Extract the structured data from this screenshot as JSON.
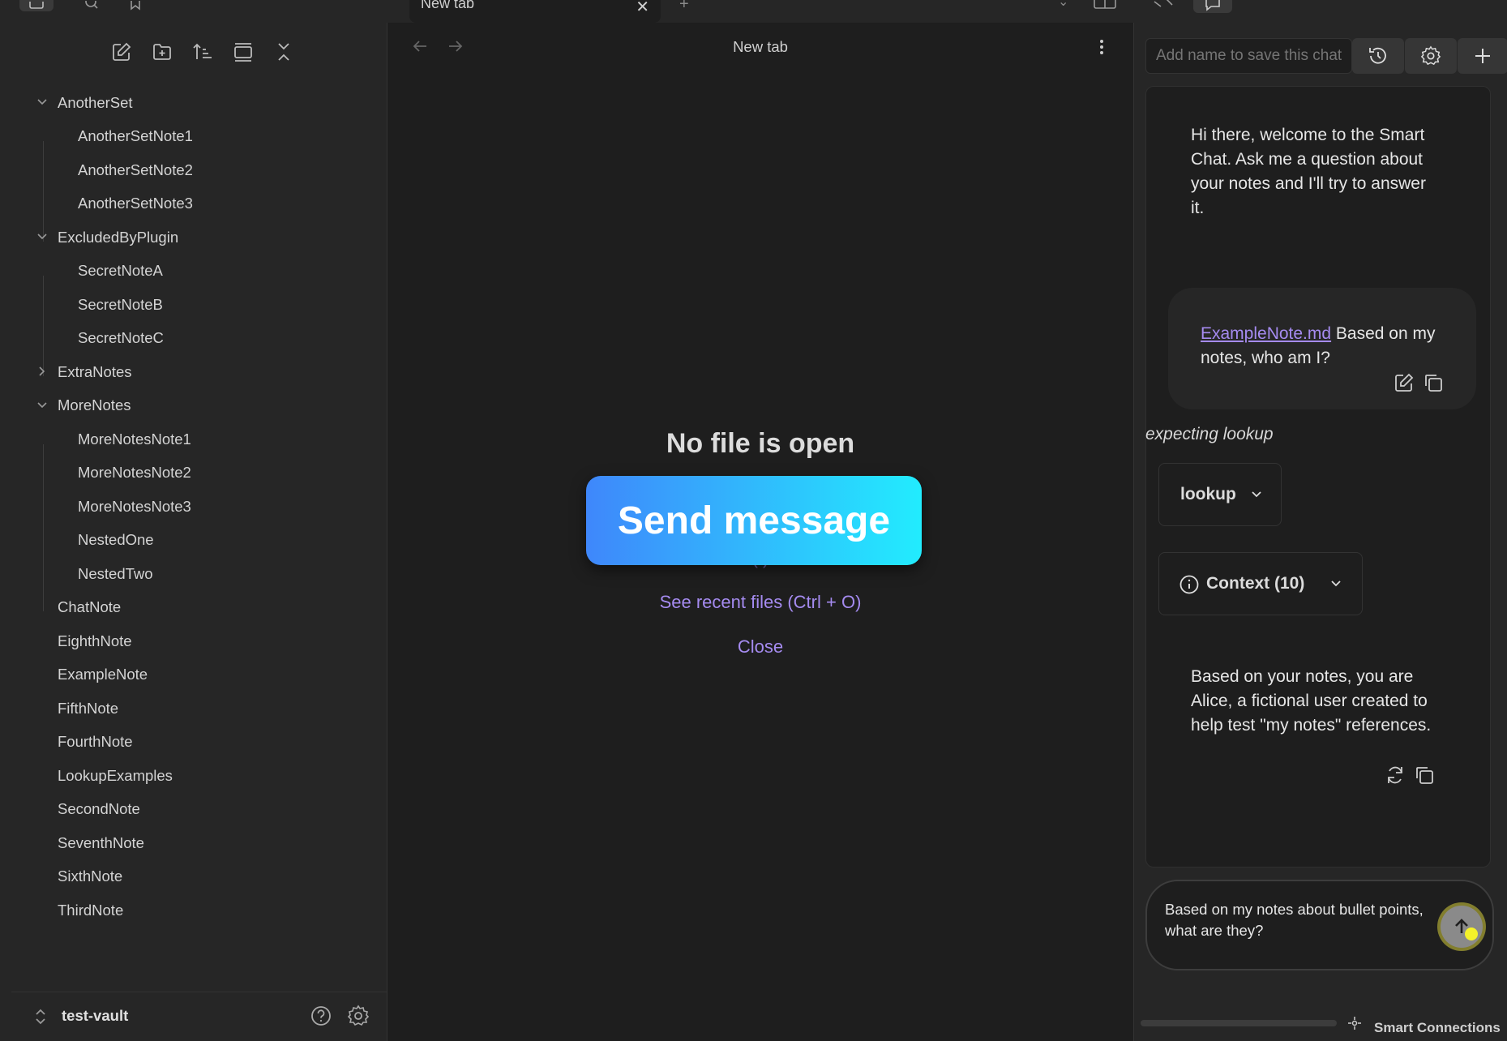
{
  "tabs": {
    "active_title": "New tab",
    "close_glyph": "✕",
    "new_tab_glyph": "+"
  },
  "sidebar": {
    "tools": [
      "new-note-icon",
      "new-folder-icon",
      "sort-icon",
      "auto-reveal-icon",
      "collapse-all-icon"
    ],
    "tree": [
      {
        "type": "folder",
        "label": "AnotherSet",
        "expanded": true
      },
      {
        "type": "child",
        "label": "AnotherSetNote1"
      },
      {
        "type": "child",
        "label": "AnotherSetNote2"
      },
      {
        "type": "child",
        "label": "AnotherSetNote3"
      },
      {
        "type": "folder",
        "label": "ExcludedByPlugin",
        "expanded": true
      },
      {
        "type": "child",
        "label": "SecretNoteA"
      },
      {
        "type": "child",
        "label": "SecretNoteB"
      },
      {
        "type": "child",
        "label": "SecretNoteC"
      },
      {
        "type": "folder",
        "label": "ExtraNotes",
        "expanded": false
      },
      {
        "type": "folder",
        "label": "MoreNotes",
        "expanded": true
      },
      {
        "type": "child",
        "label": "MoreNotesNote1"
      },
      {
        "type": "child",
        "label": "MoreNotesNote2"
      },
      {
        "type": "child",
        "label": "MoreNotesNote3"
      },
      {
        "type": "child",
        "label": "NestedOne"
      },
      {
        "type": "child",
        "label": "NestedTwo"
      },
      {
        "type": "file",
        "label": "ChatNote"
      },
      {
        "type": "file",
        "label": "EighthNote"
      },
      {
        "type": "file",
        "label": "ExampleNote"
      },
      {
        "type": "file",
        "label": "FifthNote"
      },
      {
        "type": "file",
        "label": "FourthNote"
      },
      {
        "type": "file",
        "label": "LookupExamples"
      },
      {
        "type": "file",
        "label": "SecondNote"
      },
      {
        "type": "file",
        "label": "SeventhNote"
      },
      {
        "type": "file",
        "label": "SixthNote"
      },
      {
        "type": "file",
        "label": "ThirdNote"
      }
    ],
    "vault_name": "test-vault"
  },
  "main": {
    "title": "New tab",
    "empty_title": "No file is open",
    "overlay_button": "Send message",
    "actions": {
      "hidden_fragment": "(        )",
      "recent": "See recent files (Ctrl + O)",
      "close": "Close"
    }
  },
  "chat": {
    "name_placeholder": "Add name to save this chat",
    "welcome": "Hi there, welcome to the Smart Chat. Ask me a question about your notes and I'll try to answer it.",
    "user_message": {
      "link": "ExampleNote.md",
      "text": " Based on my notes, who am I?"
    },
    "expecting": "expecting lookup",
    "lookup_label": "lookup",
    "context_label": "Context (10)",
    "answer": "Based on your notes, you are Alice, a fictional user created to help test \"my notes\" references.",
    "input_text": "Based on my notes about bullet points, what are they?",
    "footer_label": "Smart Connections"
  },
  "colors": {
    "accent": "#a58bf0",
    "send_gradient_start": "#3f87fb",
    "send_gradient_end": "#22ecfe",
    "cursor": "#f5f12a"
  }
}
